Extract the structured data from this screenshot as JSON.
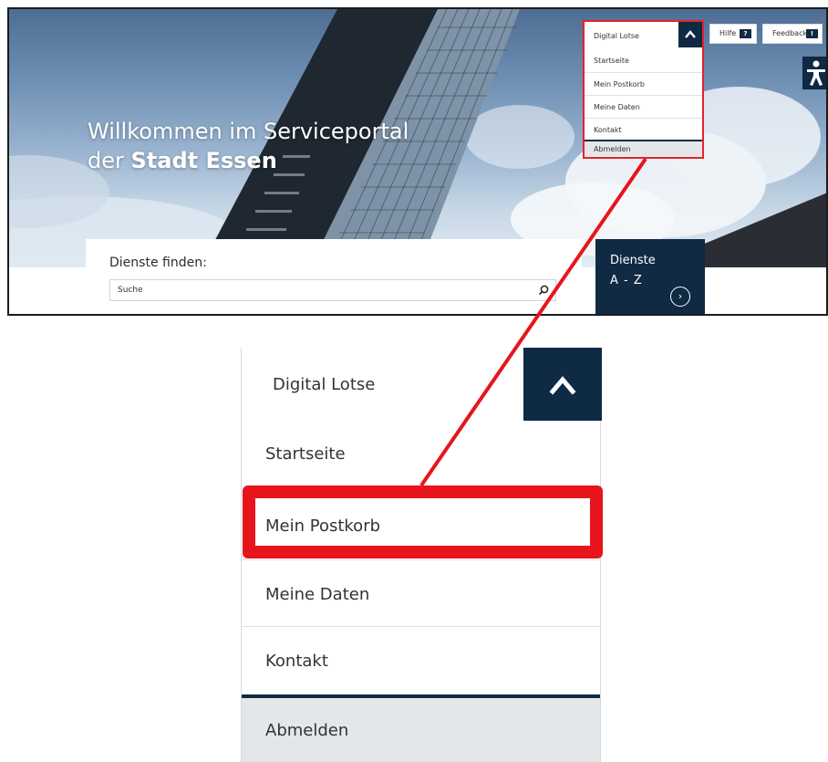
{
  "hero": {
    "welcome_line1": "Willkommen im Serviceportal",
    "welcome_line2_prefix": "der ",
    "welcome_line2_strong": "Stadt Essen"
  },
  "search": {
    "title": "Dienste finden:",
    "placeholder": "Suche"
  },
  "az_tile": {
    "line1": "Dienste",
    "line2": "A - Z"
  },
  "top_buttons": {
    "hilfe": "Hilfe",
    "hilfe_badge": "?",
    "feedback": "Feedback",
    "feedback_badge": "!"
  },
  "menu": {
    "title": "Digital Lotse",
    "items": [
      "Startseite",
      "Mein Postkorb",
      "Meine Daten",
      "Kontakt",
      "Abmelden"
    ]
  },
  "icons": {
    "toggle": "chevron-up-icon",
    "search": "search-icon",
    "az_arrow": "chevron-right-icon",
    "accessibility": "accessibility-icon"
  },
  "colors": {
    "navy": "#0e2a44",
    "highlight_red": "#e8141c"
  }
}
